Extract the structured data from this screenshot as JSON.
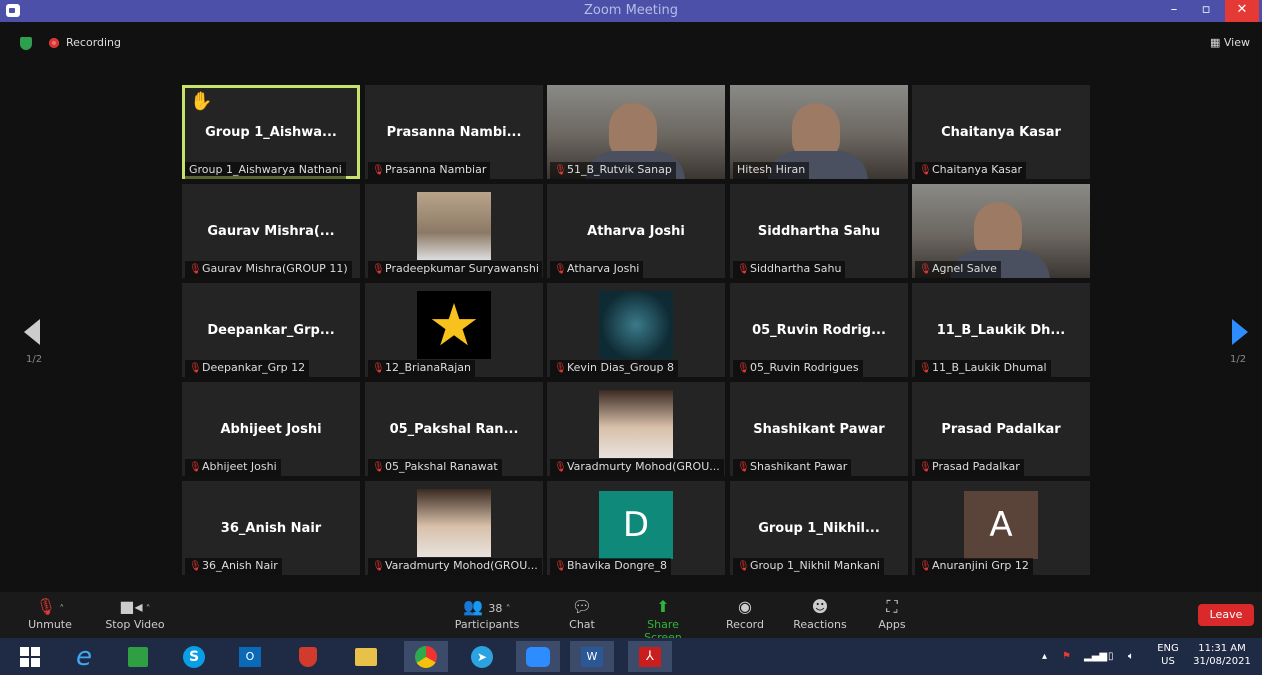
{
  "window": {
    "title": "Zoom Meeting",
    "minimize": "–",
    "maximize": "▫",
    "close": "✕"
  },
  "topbar": {
    "recording": "Recording",
    "view": "View"
  },
  "gallery": {
    "page_left": "1/2",
    "page_right": "1/2",
    "tiles": [
      {
        "name": "Group 1_Aishwa...",
        "label": "Group 1_Aishwarya Nathani",
        "muted": false,
        "hand": true
      },
      {
        "name": "Prasanna Nambi...",
        "label": "Prasanna Nambiar",
        "muted": true
      },
      {
        "name": "",
        "label": "51_B_Rutvik Sanap",
        "muted": true,
        "video": true
      },
      {
        "name": "",
        "label": "Hitesh Hiran",
        "muted": false,
        "video": true
      },
      {
        "name": "Chaitanya Kasar",
        "label": "Chaitanya Kasar",
        "muted": true
      },
      {
        "name": "Gaurav Mishra(...",
        "label": "Gaurav Mishra(GROUP 11)",
        "muted": true
      },
      {
        "name": "",
        "label": "Pradeepkumar Suryawanshi",
        "muted": true,
        "photo": "man"
      },
      {
        "name": "Atharva Joshi",
        "label": "Atharva Joshi",
        "muted": true
      },
      {
        "name": "Siddhartha Sahu",
        "label": "Siddhartha Sahu",
        "muted": true
      },
      {
        "name": "",
        "label": "Agnel Salve",
        "muted": true,
        "video": true
      },
      {
        "name": "Deepankar_Grp...",
        "label": "Deepankar_Grp 12",
        "muted": true
      },
      {
        "name": "",
        "label": "12_BrianaRajan",
        "muted": true,
        "photo": "star"
      },
      {
        "name": "",
        "label": "Kevin Dias_Group 8",
        "muted": true,
        "photo": "jar"
      },
      {
        "name": "05_Ruvin Rodrig...",
        "label": "05_Ruvin Rodrigues",
        "muted": true
      },
      {
        "name": "11_B_Laukik Dh...",
        "label": "11_B_Laukik Dhumal",
        "muted": true
      },
      {
        "name": "Abhijeet Joshi",
        "label": "Abhijeet Joshi",
        "muted": true
      },
      {
        "name": "05_Pakshal Ran...",
        "label": "05_Pakshal Ranawat",
        "muted": true
      },
      {
        "name": "",
        "label": "Varadmurty Mohod(GROU...",
        "muted": true,
        "photo": "curly"
      },
      {
        "name": "Shashikant Pawar",
        "label": "Shashikant Pawar",
        "muted": true
      },
      {
        "name": "Prasad Padalkar",
        "label": "Prasad Padalkar",
        "muted": true
      },
      {
        "name": "36_Anish Nair",
        "label": "36_Anish Nair",
        "muted": true
      },
      {
        "name": "",
        "label": "Varadmurty Mohod(GROU...",
        "muted": true,
        "photo": "curly"
      },
      {
        "name": "",
        "label": "Bhavika Dongre_8",
        "muted": true,
        "letter": "D",
        "letter_bg": "#0f8a7a"
      },
      {
        "name": "Group 1_Nikhil...",
        "label": "Group 1_Nikhil Mankani",
        "muted": true
      },
      {
        "name": "",
        "label": "Anuranjini Grp 12",
        "muted": true,
        "letter": "A",
        "letter_bg": "#5a4338"
      }
    ]
  },
  "toolbar": {
    "unmute": "Unmute",
    "stop_video": "Stop Video",
    "participants": "Participants",
    "participant_count": "38",
    "chat": "Chat",
    "share_screen": "Share Screen",
    "record": "Record",
    "reactions": "Reactions",
    "apps": "Apps",
    "leave": "Leave"
  },
  "taskbar": {
    "lang_top": "ENG",
    "lang_bottom": "US",
    "time": "11:31 AM",
    "date": "31/08/2021"
  },
  "colors": {
    "titlebar": "#4c50a8",
    "active_speaker": "#c7e36a",
    "leave": "#d9292b",
    "share": "#2fb53d"
  }
}
